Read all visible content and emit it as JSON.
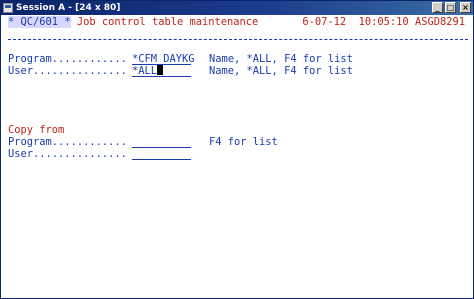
{
  "window": {
    "title": "Session A - [24 x 80]",
    "buttons": {
      "minimize": "_",
      "maximize": "□",
      "close": "×"
    }
  },
  "header": {
    "marker_left": "*",
    "program_id": "QC/601",
    "marker_right": "*",
    "screen_title": "Job control table maintenance",
    "date": "6-07-12",
    "time": "10:05:10",
    "system": "ASGD8291"
  },
  "form": {
    "program_label": "Program............",
    "program_value": "*CFM_DAYKG",
    "program_hint": "Name, *ALL, F4 for list",
    "user_label": "User...............",
    "user_value": "*ALL",
    "user_hint": "Name, *ALL, F4 for list"
  },
  "copy_from": {
    "heading": "Copy from",
    "program_label": "Program............",
    "program_value": "",
    "program_hint": "F4 for list",
    "user_label": "User...............",
    "user_value": ""
  }
}
